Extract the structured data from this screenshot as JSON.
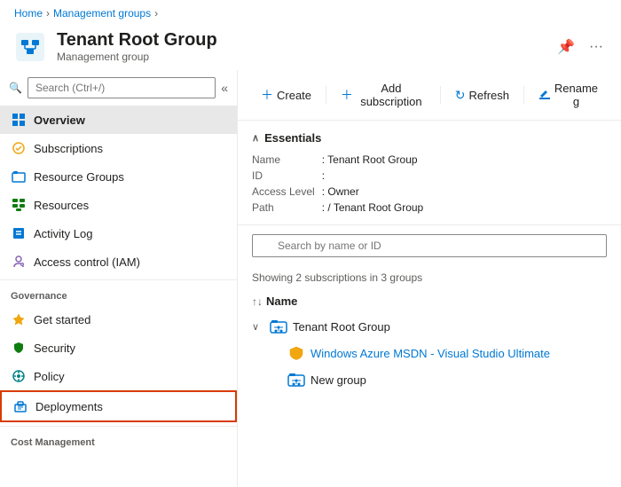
{
  "breadcrumb": {
    "home": "Home",
    "management_groups": "Management groups",
    "current": "Tenant Root Group"
  },
  "header": {
    "title": "Tenant Root Group",
    "subtitle": "Management group",
    "pin_icon": "📌",
    "more_icon": "···"
  },
  "toolbar": {
    "create_label": "Create",
    "add_subscription_label": "Add subscription",
    "refresh_label": "Refresh",
    "rename_label": "Rename g"
  },
  "search": {
    "sidebar_placeholder": "Search (Ctrl+/)",
    "content_placeholder": "Search by name or ID"
  },
  "sidebar": {
    "items": [
      {
        "id": "overview",
        "label": "Overview",
        "icon": "grid",
        "active": true
      },
      {
        "id": "subscriptions",
        "label": "Subscriptions",
        "icon": "sub"
      },
      {
        "id": "resource-groups",
        "label": "Resource Groups",
        "icon": "rg"
      },
      {
        "id": "resources",
        "label": "Resources",
        "icon": "res"
      },
      {
        "id": "activity-log",
        "label": "Activity Log",
        "icon": "log"
      },
      {
        "id": "access-control",
        "label": "Access control (IAM)",
        "icon": "iam"
      }
    ],
    "governance_section": "Governance",
    "governance_items": [
      {
        "id": "get-started",
        "label": "Get started",
        "icon": "star"
      },
      {
        "id": "security",
        "label": "Security",
        "icon": "security"
      },
      {
        "id": "policy",
        "label": "Policy",
        "icon": "policy"
      },
      {
        "id": "deployments",
        "label": "Deployments",
        "icon": "deploy",
        "highlighted": true
      }
    ],
    "cost_section": "Cost Management"
  },
  "essentials": {
    "title": "Essentials",
    "name_label": "Name",
    "name_value": "Tenant Root Group",
    "id_label": "ID",
    "id_value": "",
    "access_label": "Access Level",
    "access_value": "Owner",
    "path_label": "Path",
    "path_value": "/ Tenant Root Group"
  },
  "content": {
    "sub_count": "Showing 2 subscriptions in 3 groups",
    "name_col": "Name",
    "tree": [
      {
        "id": "tenant-root",
        "label": "Tenant Root Group",
        "type": "group",
        "expanded": true,
        "children": [
          {
            "id": "azure-msdn",
            "label": "Windows Azure MSDN - Visual Studio Ultimate",
            "type": "subscription",
            "link": true
          },
          {
            "id": "new-group",
            "label": "New group",
            "type": "group",
            "link": false
          }
        ]
      }
    ]
  }
}
